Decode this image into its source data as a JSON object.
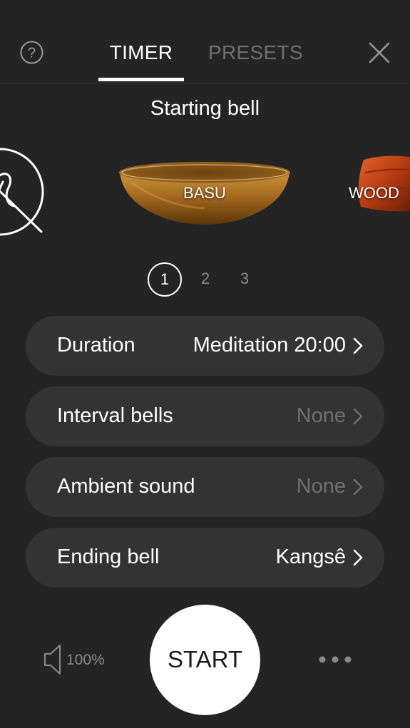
{
  "header": {
    "tabs": [
      {
        "label": "TIMER",
        "active": true
      },
      {
        "label": "PRESETS",
        "active": false
      }
    ],
    "help_icon": "question-circle-icon",
    "close_icon": "close-x-icon"
  },
  "bells": {
    "title": "Starting bell",
    "items": [
      {
        "label": "",
        "icon": "no-bell-icon"
      },
      {
        "label": "BASU",
        "icon": "singing-bowl-image"
      },
      {
        "label": "WOOD",
        "icon": "wood-block-image"
      }
    ],
    "pages": [
      "1",
      "2",
      "3"
    ],
    "active_page": "1"
  },
  "settings": [
    {
      "label": "Duration",
      "value": "Meditation 20:00",
      "value_set": true
    },
    {
      "label": "Interval bells",
      "value": "None",
      "value_set": false
    },
    {
      "label": "Ambient sound",
      "value": "None",
      "value_set": false
    },
    {
      "label": "Ending bell",
      "value": "Kangsê",
      "value_set": true
    }
  ],
  "footer": {
    "volume_icon": "speaker-icon",
    "volume_label": "100%",
    "start_label": "START",
    "more_icon": "more-dots-icon"
  },
  "colors": {
    "background": "#242424",
    "row_background": "#333333",
    "dim_text": "#6f6f6f",
    "accent": "#ffffff"
  }
}
